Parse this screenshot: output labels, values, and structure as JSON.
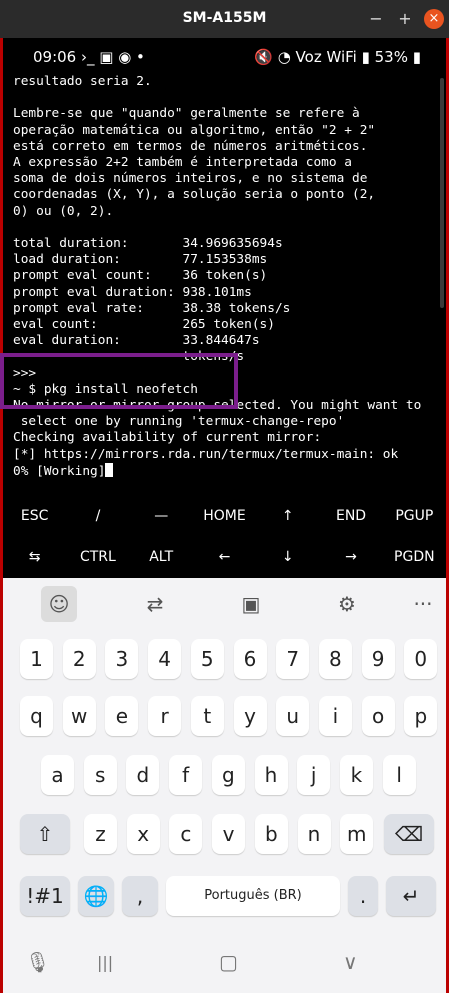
{
  "window": {
    "title": "SM-A155M",
    "min": "−",
    "max": "+",
    "close": "×"
  },
  "status": {
    "time": "09:06 ›_ ▣ ◉ •",
    "right": "🔇 ◔ Voz WiFi ▮ 53% ▮"
  },
  "terminal": {
    "lines": [
      "resultado seria 2.",
      "",
      "Lembre-se que \"quando\" geralmente se refere à",
      "operação matemática ou algoritmo, então \"2 + 2\"",
      "está correto em termos de números aritméticos.",
      "A expressão 2+2 também é interpretada como a",
      "soma de dois números inteiros, e no sistema de",
      "coordenadas (X, Y), a solução seria o ponto (2,",
      "0) ou (0, 2).",
      "",
      "total duration:       34.969635694s",
      "load duration:        77.153538ms",
      "prompt eval count:    36 token(s)",
      "prompt eval duration: 938.101ms",
      "prompt eval rate:     38.38 tokens/s",
      "eval count:           265 token(s)",
      "eval duration:        33.844647s",
      "                      tokens/s",
      ">>>",
      "~ $ pkg install neofetch",
      "No mirror or mirror group selected. You might want to",
      " select one by running 'termux-change-repo'",
      "Checking availability of current mirror:",
      "[*] https://mirrors.rda.run/termux/termux-main: ok",
      "0% [Working]"
    ]
  },
  "extra_keys": {
    "row1": [
      "ESC",
      "/",
      "—",
      "HOME",
      "↑",
      "END",
      "PGUP"
    ],
    "row2": [
      "⇆",
      "CTRL",
      "ALT",
      "←",
      "↓",
      "→",
      "PGDN"
    ]
  },
  "keyboard": {
    "toolbar": [
      "☺",
      "⇄",
      "▣",
      "⚙",
      "···"
    ],
    "numbers": [
      "1",
      "2",
      "3",
      "4",
      "5",
      "6",
      "7",
      "8",
      "9",
      "0"
    ],
    "row1": [
      "q",
      "w",
      "e",
      "r",
      "t",
      "y",
      "u",
      "i",
      "o",
      "p"
    ],
    "row2": [
      "a",
      "s",
      "d",
      "f",
      "g",
      "h",
      "j",
      "k",
      "l"
    ],
    "row3": [
      "z",
      "x",
      "c",
      "v",
      "b",
      "n",
      "m"
    ],
    "shift": "⇧",
    "backspace": "⌫",
    "symbols": "!#1",
    "globe": "🌐",
    "comma": ",",
    "space": "Português (BR)",
    "period": ".",
    "enter": "↵"
  },
  "nav": {
    "mic": "🎙",
    "recents": "|||",
    "home": "▢",
    "back": "∨"
  }
}
